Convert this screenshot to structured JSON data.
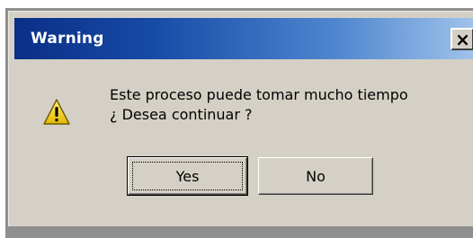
{
  "dialog": {
    "title": "Warning",
    "close_label": "×",
    "icon": "warning-icon",
    "message_line1": "Este proceso puede tomar mucho tiempo",
    "message_line2": "¿ Desea continuar ?"
  },
  "buttons": {
    "yes_label": "Yes",
    "no_label": "No"
  },
  "colors": {
    "titlebar_start": "#0a2f86",
    "titlebar_end": "#9fc2ea",
    "dialog_bg": "#d5d0c6",
    "warning_yellow": "#f5cf1a"
  }
}
